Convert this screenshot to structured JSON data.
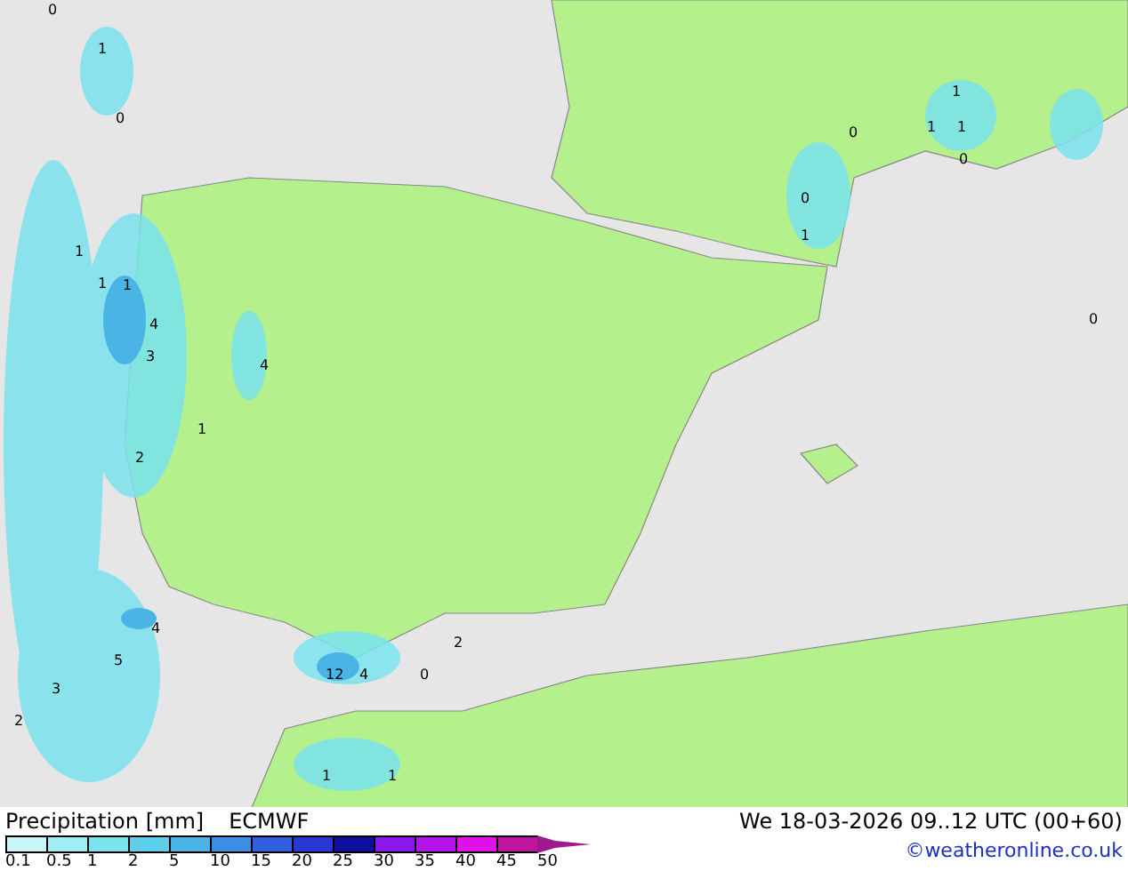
{
  "map": {
    "labels": [
      "0",
      "1",
      "0",
      "1",
      "1",
      "1",
      "0",
      "0",
      "0",
      "1",
      "1",
      "1",
      "1",
      "4",
      "3",
      "4",
      "2",
      "1",
      "4",
      "12",
      "4",
      "2",
      "0",
      "1",
      "1",
      "0",
      "5",
      "3",
      "2"
    ]
  },
  "legend": {
    "title": "Precipitation [mm]",
    "model": "ECMWF",
    "valid_time": "We 18-03-2026 09..12 UTC (00+60)",
    "credit": "©weatheronline.co.uk",
    "scale": [
      {
        "label": "0.1",
        "color": "#c8f5f8"
      },
      {
        "label": "0.5",
        "color": "#a0eef4"
      },
      {
        "label": "1",
        "color": "#7ae3ee"
      },
      {
        "label": "2",
        "color": "#5cd0ea"
      },
      {
        "label": "5",
        "color": "#4ab4e6"
      },
      {
        "label": "10",
        "color": "#3c8ee4"
      },
      {
        "label": "15",
        "color": "#3060e0"
      },
      {
        "label": "20",
        "color": "#2838d0"
      },
      {
        "label": "25",
        "color": "#10109c"
      },
      {
        "label": "30",
        "color": "#8a18e8"
      },
      {
        "label": "35",
        "color": "#b414e8"
      },
      {
        "label": "40",
        "color": "#e010e8"
      },
      {
        "label": "45",
        "color": "#c0149c"
      },
      {
        "label": "50",
        "color": "#a01890"
      }
    ]
  }
}
